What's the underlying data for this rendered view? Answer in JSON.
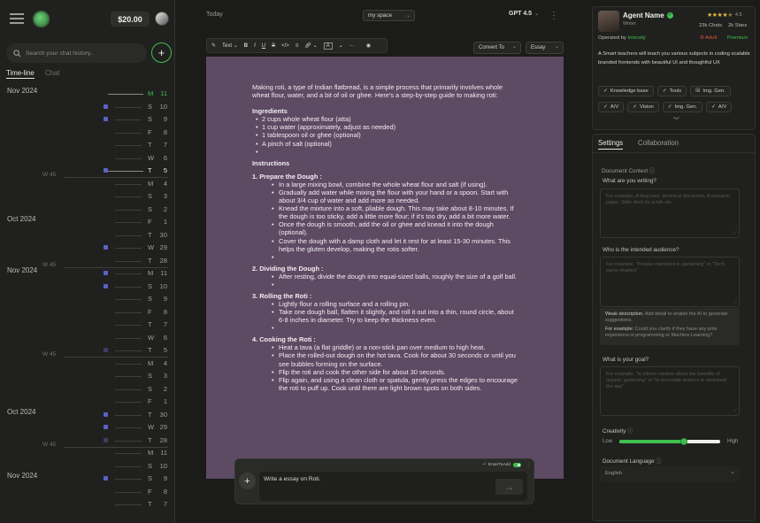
{
  "sidebar": {
    "balance": "$20.00",
    "search_placeholder": "Search your chat history..",
    "tabs": [
      {
        "label": "Time-line"
      },
      {
        "label": "Chat"
      }
    ],
    "months": [
      "Nov 2024",
      "Oct 2024",
      "Nov 2024",
      "Oct 2024",
      "Nov 2024"
    ],
    "weeks": [
      "W 45",
      "W 45",
      "W 45",
      "W 45"
    ],
    "days": [
      {
        "d": "M",
        "n": "11"
      },
      {
        "d": "S",
        "n": "10"
      },
      {
        "d": "S",
        "n": "9"
      },
      {
        "d": "F",
        "n": "8"
      },
      {
        "d": "T",
        "n": "7"
      },
      {
        "d": "W",
        "n": "6"
      },
      {
        "d": "T",
        "n": "5"
      },
      {
        "d": "M",
        "n": "4"
      },
      {
        "d": "S",
        "n": "3"
      },
      {
        "d": "S",
        "n": "2"
      },
      {
        "d": "F",
        "n": "1"
      },
      {
        "d": "T",
        "n": "30"
      },
      {
        "d": "W",
        "n": "29"
      },
      {
        "d": "T",
        "n": "28"
      },
      {
        "d": "M",
        "n": "11"
      },
      {
        "d": "S",
        "n": "10"
      },
      {
        "d": "S",
        "n": "9"
      },
      {
        "d": "F",
        "n": "8"
      },
      {
        "d": "T",
        "n": "7"
      },
      {
        "d": "W",
        "n": "6"
      },
      {
        "d": "T",
        "n": "5"
      },
      {
        "d": "M",
        "n": "4"
      },
      {
        "d": "S",
        "n": "3"
      },
      {
        "d": "S",
        "n": "2"
      },
      {
        "d": "F",
        "n": "1"
      },
      {
        "d": "T",
        "n": "30"
      },
      {
        "d": "W",
        "n": "29"
      },
      {
        "d": "T",
        "n": "28"
      },
      {
        "d": "M",
        "n": "11"
      },
      {
        "d": "S",
        "n": "10"
      },
      {
        "d": "S",
        "n": "9"
      },
      {
        "d": "F",
        "n": "8"
      },
      {
        "d": "T",
        "n": "7"
      }
    ]
  },
  "header": {
    "today_label": "Today",
    "space_select": "my space",
    "model_label": "GPT 4.5"
  },
  "toolbar": {
    "text_style": "Text",
    "bold": "B",
    "italic": "I",
    "underline": "U",
    "strike": "S",
    "code": "</>",
    "color_label": "A",
    "more": "···",
    "convert_label": "Convert To",
    "essay_label": "Essay"
  },
  "document": {
    "intro": "Making roti, a type of Indian flatbread, is a simple process that primarily involves whole wheat flour, water, and a bit of oil or ghee. Here's a step-by-step guide to making roti:",
    "ingredients_heading": "Ingredients",
    "ingredients": [
      "2 cups whole wheat flour (atta)",
      "1 cup water (approximately, adjust as needed)",
      "1 tablespoon oil or ghee (optional)",
      "A pinch of salt (optional)",
      ""
    ],
    "instructions_heading": "Instructions",
    "steps": [
      {
        "title": "1. Prepare the Dough :",
        "items": [
          "In a large mixing bowl, combine the whole wheat flour and salt (if using).",
          "Gradually add water while mixing the flour with your hand or a spoon. Start with about 3/4 cup of water and add more as needed.",
          "Knead the mixture into a soft, pliable dough. This may take about 8-10 minutes. If the dough is too sticky, add a little more flour; if it's too dry, add a bit more water.",
          "Once the dough is smooth, add the oil or ghee and knead it into the dough (optional).",
          "Cover the dough with a damp cloth and let it rest for at least 15-30 minutes. This helps the gluten develop, making the rotis softer.",
          ""
        ]
      },
      {
        "title": "2. Dividing the Dough :",
        "items": [
          "After resting, divide the dough into equal-sized balls, roughly the size of a golf ball.",
          ""
        ]
      },
      {
        "title": "3. Rolling the Roti :",
        "items": [
          "Lightly flour a rolling surface and a rolling pin.",
          "Take one dough ball, flatten it slightly, and roll it out into a thin, round circle, about 6-8 inches in diameter. Try to keep the thickness even.",
          ""
        ]
      },
      {
        "title": "4. Cooking the Roti :",
        "items": [
          "Heat a tava (a flat griddle) or a non-stick pan over medium to high heat.",
          "Place the rolled-out dough on the hot tava. Cook for about 30 seconds or until you see bubbles forming on the surface.",
          "Flip the roti and cook the other side for about 30 seconds.",
          "Flip again, and using a clean cloth or spatula, gently press the edges to encourage the roti to puff up. Cook until there are light brown spots on both sides."
        ]
      }
    ]
  },
  "composer": {
    "enter_to_add": "EnterToAdd",
    "input_value": "Write a essay on Roti."
  },
  "agent": {
    "name": "Agent Name",
    "role": "Writer",
    "rating": "4.5",
    "stars": 4.5,
    "chats": "23k Chats",
    "star_count": "2k Stars",
    "operated_by": "Operated by",
    "operator": "Intersity",
    "adult": "Adult",
    "premium": "Premium",
    "description": "A Smart teachers will teach you various subjects in coding scalable branded frontends with beautiful UI and thoughtful UX",
    "capabilities": [
      "Knowledge base",
      "Tools",
      "Img. Gen.",
      "A/V",
      "Vision",
      "Img. Gen.",
      "A/V"
    ]
  },
  "settings": {
    "tabs": [
      {
        "label": "Settings"
      },
      {
        "label": "Collaboration"
      }
    ],
    "section_title": "Document Context",
    "q1": "What are you writing?",
    "q1_placeholder": "For example, A blog post, technical document, A research paper, Slide deck for a talk etc.",
    "q2": "Who is the intended audience?",
    "q2_placeholder": "For example, \"People interested in gardening\" or \"Tech-savvy readers\"",
    "weak_title": "Weak description.",
    "weak_text": "Add detail to enable the AI to generate suggestions.",
    "example_title": "For example:",
    "example_text": "Could you clarify if they have any prior experience in programming or Machine Learning?",
    "q3": "What is your goal?",
    "q3_placeholder": "For example, \"to inform readers about the benefits of organic gardening\" or \"to persuade readers to download the app\"",
    "creativity_label": "Creativity",
    "creativity_low": "Low",
    "creativity_high": "High",
    "creativity_level": 0.64,
    "language_label": "Document Language",
    "language_value": "English"
  },
  "colors": {
    "accent_green": "#3fbf4f",
    "doc_bg": "#5d4a63",
    "marker_blue": "#5b62c8",
    "badge_red": "#e0533d"
  }
}
